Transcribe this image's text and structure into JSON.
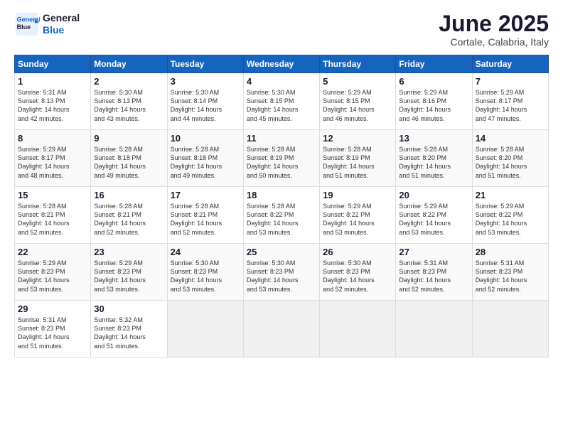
{
  "logo": {
    "line1": "General",
    "line2": "Blue"
  },
  "title": "June 2025",
  "subtitle": "Cortale, Calabria, Italy",
  "headers": [
    "Sunday",
    "Monday",
    "Tuesday",
    "Wednesday",
    "Thursday",
    "Friday",
    "Saturday"
  ],
  "weeks": [
    [
      {
        "day": "1",
        "lines": [
          "Sunrise: 5:31 AM",
          "Sunset: 8:13 PM",
          "Daylight: 14 hours",
          "and 42 minutes."
        ]
      },
      {
        "day": "2",
        "lines": [
          "Sunrise: 5:30 AM",
          "Sunset: 8:13 PM",
          "Daylight: 14 hours",
          "and 43 minutes."
        ]
      },
      {
        "day": "3",
        "lines": [
          "Sunrise: 5:30 AM",
          "Sunset: 8:14 PM",
          "Daylight: 14 hours",
          "and 44 minutes."
        ]
      },
      {
        "day": "4",
        "lines": [
          "Sunrise: 5:30 AM",
          "Sunset: 8:15 PM",
          "Daylight: 14 hours",
          "and 45 minutes."
        ]
      },
      {
        "day": "5",
        "lines": [
          "Sunrise: 5:29 AM",
          "Sunset: 8:15 PM",
          "Daylight: 14 hours",
          "and 46 minutes."
        ]
      },
      {
        "day": "6",
        "lines": [
          "Sunrise: 5:29 AM",
          "Sunset: 8:16 PM",
          "Daylight: 14 hours",
          "and 46 minutes."
        ]
      },
      {
        "day": "7",
        "lines": [
          "Sunrise: 5:29 AM",
          "Sunset: 8:17 PM",
          "Daylight: 14 hours",
          "and 47 minutes."
        ]
      }
    ],
    [
      {
        "day": "8",
        "lines": [
          "Sunrise: 5:29 AM",
          "Sunset: 8:17 PM",
          "Daylight: 14 hours",
          "and 48 minutes."
        ]
      },
      {
        "day": "9",
        "lines": [
          "Sunrise: 5:28 AM",
          "Sunset: 8:18 PM",
          "Daylight: 14 hours",
          "and 49 minutes."
        ]
      },
      {
        "day": "10",
        "lines": [
          "Sunrise: 5:28 AM",
          "Sunset: 8:18 PM",
          "Daylight: 14 hours",
          "and 49 minutes."
        ]
      },
      {
        "day": "11",
        "lines": [
          "Sunrise: 5:28 AM",
          "Sunset: 8:19 PM",
          "Daylight: 14 hours",
          "and 50 minutes."
        ]
      },
      {
        "day": "12",
        "lines": [
          "Sunrise: 5:28 AM",
          "Sunset: 8:19 PM",
          "Daylight: 14 hours",
          "and 51 minutes."
        ]
      },
      {
        "day": "13",
        "lines": [
          "Sunrise: 5:28 AM",
          "Sunset: 8:20 PM",
          "Daylight: 14 hours",
          "and 51 minutes."
        ]
      },
      {
        "day": "14",
        "lines": [
          "Sunrise: 5:28 AM",
          "Sunset: 8:20 PM",
          "Daylight: 14 hours",
          "and 51 minutes."
        ]
      }
    ],
    [
      {
        "day": "15",
        "lines": [
          "Sunrise: 5:28 AM",
          "Sunset: 8:21 PM",
          "Daylight: 14 hours",
          "and 52 minutes."
        ]
      },
      {
        "day": "16",
        "lines": [
          "Sunrise: 5:28 AM",
          "Sunset: 8:21 PM",
          "Daylight: 14 hours",
          "and 52 minutes."
        ]
      },
      {
        "day": "17",
        "lines": [
          "Sunrise: 5:28 AM",
          "Sunset: 8:21 PM",
          "Daylight: 14 hours",
          "and 52 minutes."
        ]
      },
      {
        "day": "18",
        "lines": [
          "Sunrise: 5:28 AM",
          "Sunset: 8:22 PM",
          "Daylight: 14 hours",
          "and 53 minutes."
        ]
      },
      {
        "day": "19",
        "lines": [
          "Sunrise: 5:29 AM",
          "Sunset: 8:22 PM",
          "Daylight: 14 hours",
          "and 53 minutes."
        ]
      },
      {
        "day": "20",
        "lines": [
          "Sunrise: 5:29 AM",
          "Sunset: 8:22 PM",
          "Daylight: 14 hours",
          "and 53 minutes."
        ]
      },
      {
        "day": "21",
        "lines": [
          "Sunrise: 5:29 AM",
          "Sunset: 8:22 PM",
          "Daylight: 14 hours",
          "and 53 minutes."
        ]
      }
    ],
    [
      {
        "day": "22",
        "lines": [
          "Sunrise: 5:29 AM",
          "Sunset: 8:23 PM",
          "Daylight: 14 hours",
          "and 53 minutes."
        ]
      },
      {
        "day": "23",
        "lines": [
          "Sunrise: 5:29 AM",
          "Sunset: 8:23 PM",
          "Daylight: 14 hours",
          "and 53 minutes."
        ]
      },
      {
        "day": "24",
        "lines": [
          "Sunrise: 5:30 AM",
          "Sunset: 8:23 PM",
          "Daylight: 14 hours",
          "and 53 minutes."
        ]
      },
      {
        "day": "25",
        "lines": [
          "Sunrise: 5:30 AM",
          "Sunset: 8:23 PM",
          "Daylight: 14 hours",
          "and 53 minutes."
        ]
      },
      {
        "day": "26",
        "lines": [
          "Sunrise: 5:30 AM",
          "Sunset: 8:23 PM",
          "Daylight: 14 hours",
          "and 52 minutes."
        ]
      },
      {
        "day": "27",
        "lines": [
          "Sunrise: 5:31 AM",
          "Sunset: 8:23 PM",
          "Daylight: 14 hours",
          "and 52 minutes."
        ]
      },
      {
        "day": "28",
        "lines": [
          "Sunrise: 5:31 AM",
          "Sunset: 8:23 PM",
          "Daylight: 14 hours",
          "and 52 minutes."
        ]
      }
    ],
    [
      {
        "day": "29",
        "lines": [
          "Sunrise: 5:31 AM",
          "Sunset: 8:23 PM",
          "Daylight: 14 hours",
          "and 51 minutes."
        ]
      },
      {
        "day": "30",
        "lines": [
          "Sunrise: 5:32 AM",
          "Sunset: 8:23 PM",
          "Daylight: 14 hours",
          "and 51 minutes."
        ]
      },
      {
        "day": "",
        "lines": []
      },
      {
        "day": "",
        "lines": []
      },
      {
        "day": "",
        "lines": []
      },
      {
        "day": "",
        "lines": []
      },
      {
        "day": "",
        "lines": []
      }
    ]
  ]
}
